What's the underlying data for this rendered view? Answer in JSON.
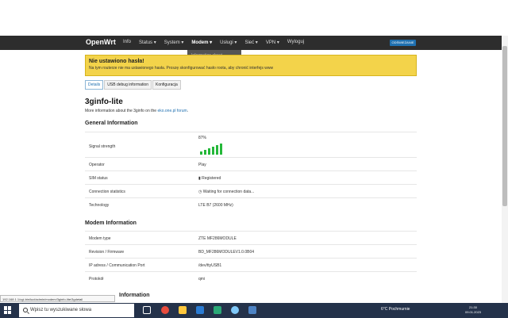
{
  "nav": {
    "brand": "OpenWrt",
    "items": [
      "Info",
      "Status ▾",
      "System ▾",
      "Modem ▾",
      "Usługi ▾",
      "Sieć ▾",
      "VPN ▾",
      "Wyloguj"
    ],
    "refresh": "ODŚWIEŻANIE"
  },
  "dropdown": {
    "item": "Information about 3G/4G/5G connection"
  },
  "warning": {
    "title": "Nie ustawiono hasła!",
    "text": "Na tym routerze nie ma ustawionego hasła. Proszę skonfigurować hasło roota, aby chronić interfejs www"
  },
  "tabs": [
    "Details",
    "USB debug information",
    "Konfiguracja"
  ],
  "page": {
    "title": "3ginfo-lite",
    "desc": "More information about the 3ginfo on the",
    "link": "eko.one.pl forum",
    "desc_end": "."
  },
  "sections": {
    "general": "General Information",
    "modem": "Modem Information",
    "partial": "Information"
  },
  "general": [
    {
      "label": "Signal strength",
      "value": "87%",
      "level": 0.87
    },
    {
      "label": "Operator",
      "value": "Play"
    },
    {
      "label": "SIM status",
      "value": "Registered"
    },
    {
      "label": "Connection statistics",
      "value": "Waiting for connection data..."
    },
    {
      "label": "Technology",
      "value": "LTE B7 (2600 MHz)"
    }
  ],
  "modem": [
    {
      "label": "Modem type",
      "value": "ZTE MF286MODULE"
    },
    {
      "label": "Revision / Firmware",
      "value": "BD_MF286MODULEV1.0.0B04"
    },
    {
      "label": "IP adress / Communication Port",
      "value": "/dev/ttyUSB1"
    },
    {
      "label": "Protokół",
      "value": "qmi"
    }
  ],
  "status_url": "192.168.1.1/cgi-bin/luci/admin/modem/3ginfo-lite/3gdetail",
  "taskbar": {
    "search": "Wpisz tu wyszukiwane słowa",
    "weather": "6°C  Pochmurnie",
    "time": "21:30",
    "date": "09.01.2023"
  },
  "colors": {
    "nav": "#2d2d2d",
    "warning": "#f3d34a",
    "accent": "#1f70b0",
    "signal": "#25b83a"
  }
}
